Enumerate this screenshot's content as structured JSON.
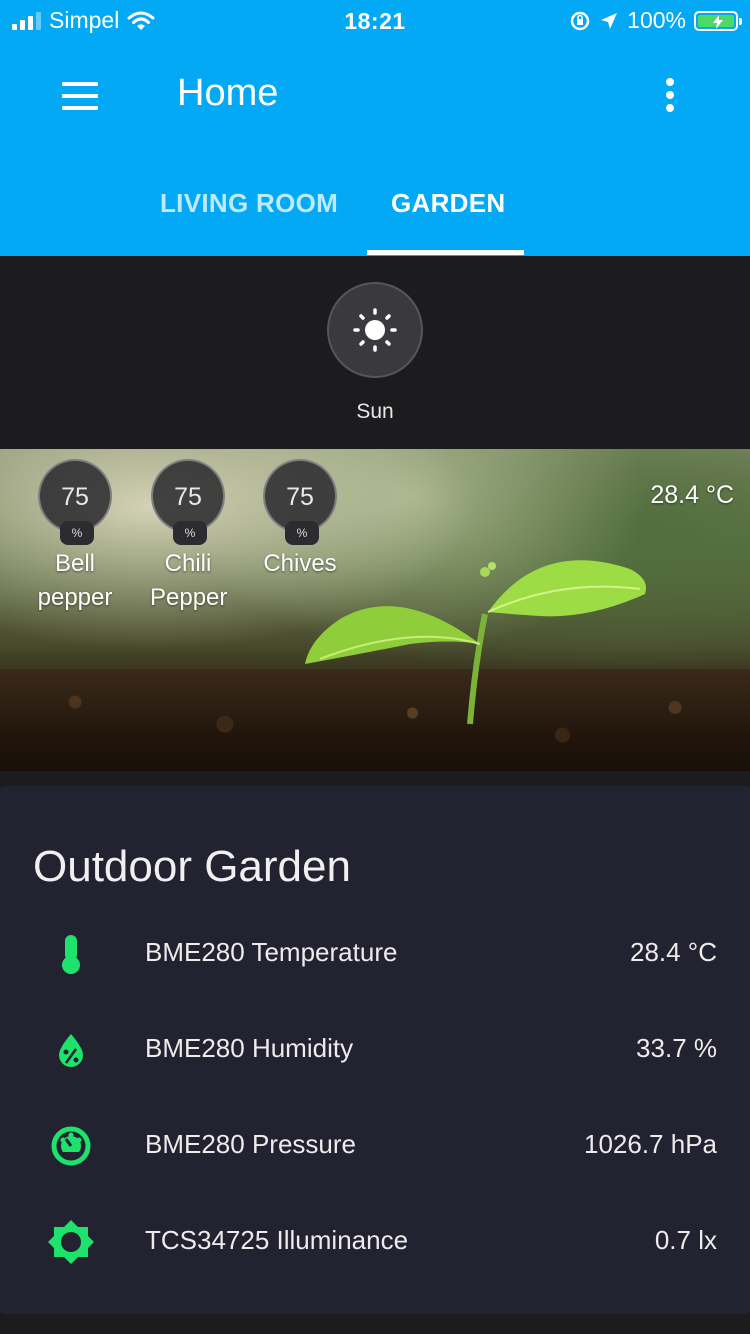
{
  "status_bar": {
    "carrier": "Simpel",
    "time": "18:21",
    "battery": "100%",
    "icons": [
      "signal-icon",
      "wifi-icon",
      "orientation-lock-icon",
      "location-icon",
      "battery-icon"
    ]
  },
  "app_bar": {
    "title": "Home",
    "tabs": [
      {
        "label": "LIVING ROOM",
        "active": false
      },
      {
        "label": "GARDEN",
        "active": true
      }
    ],
    "accent_color": "#03a9f4"
  },
  "sun": {
    "label": "Sun",
    "icon": "sun-icon"
  },
  "picture_card": {
    "temperature": "28.4 °C",
    "gauges": [
      {
        "value": "75",
        "unit": "%",
        "name_line1": "Bell",
        "name_line2": "pepper"
      },
      {
        "value": "75",
        "unit": "%",
        "name_line1": "Chili",
        "name_line2": "Pepper"
      },
      {
        "value": "75",
        "unit": "%",
        "name_line1": "Chives",
        "name_line2": ""
      }
    ]
  },
  "outdoor_garden": {
    "title": "Outdoor Garden",
    "icon_color": "#1de26c",
    "entities": [
      {
        "name": "BME280 Temperature",
        "value": "28.4 °C",
        "icon": "thermometer-icon"
      },
      {
        "name": "BME280 Humidity",
        "value": "33.7 %",
        "icon": "water-percent-icon"
      },
      {
        "name": "BME280 Pressure",
        "value": "1026.7 hPa",
        "icon": "gauge-icon"
      },
      {
        "name": "TCS34725 Illuminance",
        "value": "0.7 lx",
        "icon": "brightness-icon"
      }
    ]
  }
}
